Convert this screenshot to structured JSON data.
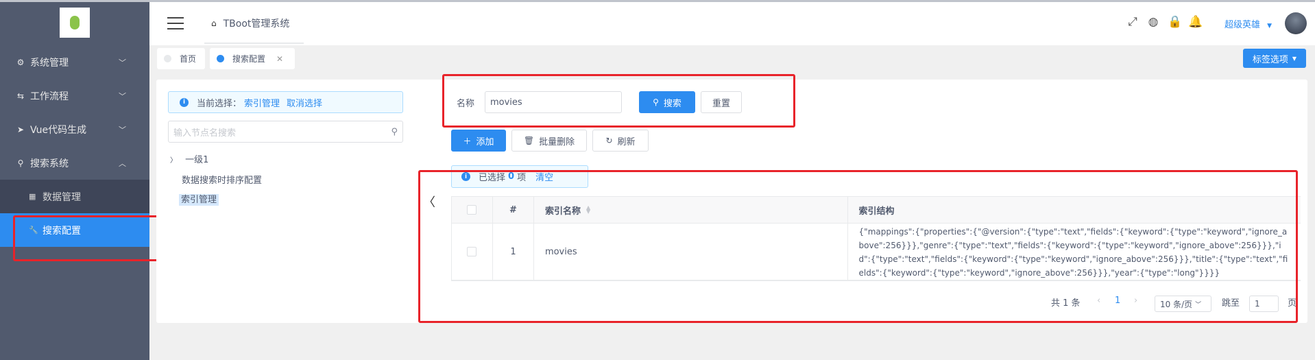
{
  "sidebar": {
    "items": [
      {
        "label": "系统管理"
      },
      {
        "label": "工作流程"
      },
      {
        "label": "Vue代码生成"
      },
      {
        "label": "搜索系统"
      }
    ],
    "sub_items": [
      {
        "label": "数据管理"
      },
      {
        "label": "搜索配置"
      }
    ]
  },
  "header": {
    "breadcrumb": "TBoot管理系统",
    "user_name": "超级英雄"
  },
  "tabs": [
    {
      "label": "首页"
    },
    {
      "label": "搜索配置"
    }
  ],
  "tag_options_label": "标签选项",
  "left_panel": {
    "current_selection_label": "当前选择：",
    "selected_node": "索引管理",
    "cancel_label": "取消选择",
    "tree_search_placeholder": "输入节点名搜索",
    "tree": [
      {
        "label": "一级1"
      },
      {
        "label": "数据搜索时排序配置"
      },
      {
        "label": "索引管理"
      }
    ]
  },
  "search_form": {
    "name_label": "名称",
    "name_value": "movies",
    "search_label": "搜索",
    "reset_label": "重置"
  },
  "toolbar": {
    "add_label": "添加",
    "batch_delete_label": "批量删除",
    "refresh_label": "刷新"
  },
  "selection_alert": {
    "prefix": "已选择",
    "count": "0",
    "suffix": "项",
    "clear_label": "清空"
  },
  "table": {
    "columns": [
      "#",
      "索引名称",
      "索引结构"
    ],
    "rows": [
      {
        "index": "1",
        "name": "movies",
        "structure": "{\"mappings\":{\"properties\":{\"@version\":{\"type\":\"text\",\"fields\":{\"keyword\":{\"type\":\"keyword\",\"ignore_above\":256}}},\"genre\":{\"type\":\"text\",\"fields\":{\"keyword\":{\"type\":\"keyword\",\"ignore_above\":256}}},\"id\":{\"type\":\"text\",\"fields\":{\"keyword\":{\"type\":\"keyword\",\"ignore_above\":256}}},\"title\":{\"type\":\"text\",\"fields\":{\"keyword\":{\"type\":\"keyword\",\"ignore_above\":256}}},\"year\":{\"type\":\"long\"}}}}"
      }
    ]
  },
  "pagination": {
    "total": "共 1 条",
    "current_page": "1",
    "page_size": "10 条/页",
    "jump_label": "跳至",
    "jump_value": "1",
    "page_suffix": "页"
  },
  "colors": {
    "sidebar_bg": "#515a6e",
    "primary": "#2d8cf0",
    "highlight_box": "#e8232a"
  }
}
